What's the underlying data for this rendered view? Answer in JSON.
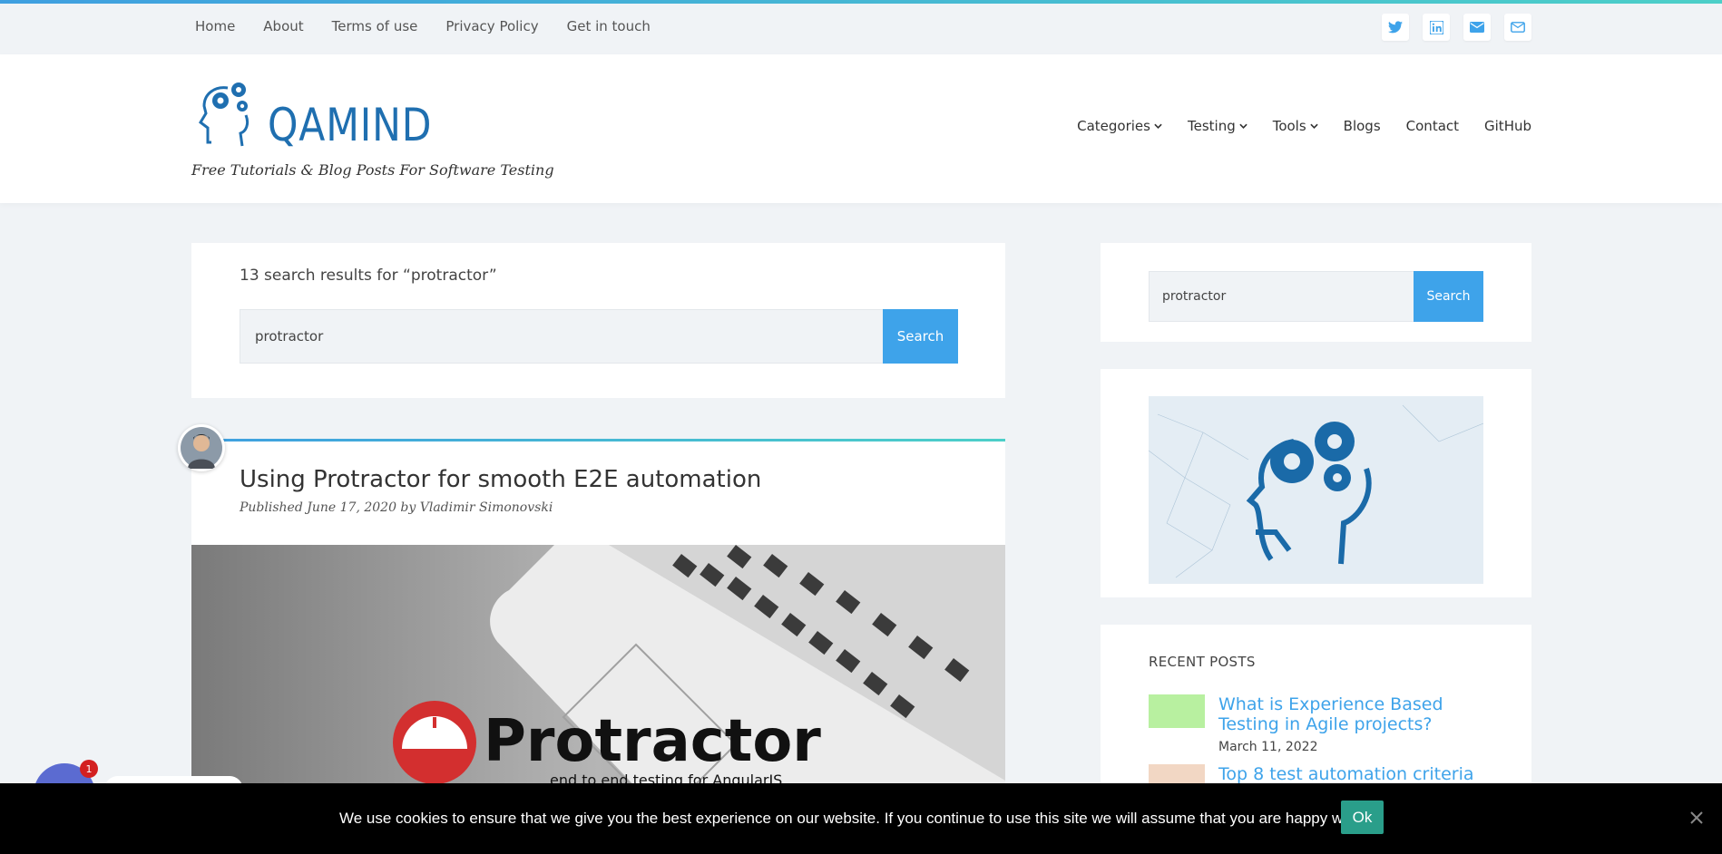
{
  "topnav": {
    "items": [
      "Home",
      "About",
      "Terms of use",
      "Privacy Policy",
      "Get in touch"
    ]
  },
  "social": {
    "icons": [
      "twitter-icon",
      "linkedin-icon",
      "envelope-icon",
      "envelope-outline-icon"
    ]
  },
  "brand": {
    "name": "QAMIND",
    "tagline": "Free Tutorials & Blog Posts For Software Testing",
    "color": "#1f6fb0"
  },
  "mainnav": {
    "categories": "Categories",
    "testing": "Testing",
    "tools": "Tools",
    "blogs": "Blogs",
    "contact": "Contact",
    "github": "GitHub"
  },
  "search": {
    "results_title": "13 search results for “protractor”",
    "value": "protractor",
    "button": "Search"
  },
  "post": {
    "title": "Using Protractor for smooth E2E automation",
    "meta": "Published June 17, 2020 by Vladimir Simonovski",
    "image_brand": "Protractor",
    "image_sub": "end to end testing for AngularJS"
  },
  "sidebar": {
    "search_value": "protractor",
    "search_button": "Search",
    "recent_title": "RECENT POSTS",
    "recent": [
      {
        "title": "What is Experience Based Testing in Agile projects?",
        "date": "March 11, 2022"
      },
      {
        "title": "Top 8 test automation criteria",
        "date": ""
      }
    ]
  },
  "cookie": {
    "text": "We use cookies to ensure that we give you the best experience on our website. If you continue to use this site we will assume that you are happy with it.",
    "ok": "Ok"
  },
  "chat": {
    "badge": "1"
  },
  "colors": {
    "accent": "#3ea3ea",
    "ok_button": "#2a9e8a"
  }
}
